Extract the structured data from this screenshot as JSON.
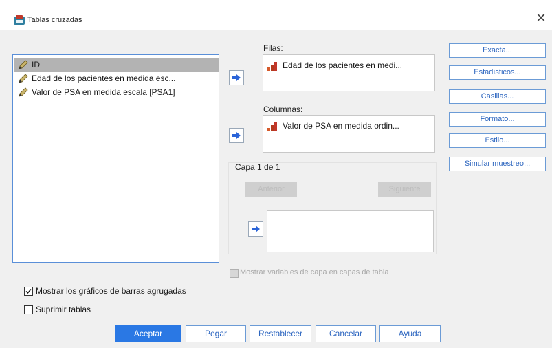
{
  "window": {
    "title": "Tablas cruzadas",
    "close_glyph": "✕"
  },
  "variables": [
    {
      "label": "ID",
      "icon": "pencil-icon",
      "selected": true
    },
    {
      "label": "Edad de los pacientes en medida esc...",
      "icon": "pencil-icon",
      "selected": false
    },
    {
      "label": "Valor de PSA en medida escala  [PSA1]",
      "icon": "pencil-icon",
      "selected": false
    }
  ],
  "rows": {
    "label": "Filas:",
    "items": [
      "Edad de los pacientes en medi..."
    ]
  },
  "columns": {
    "label": "Columnas:",
    "items": [
      "Valor de PSA en medida ordin..."
    ]
  },
  "layer": {
    "label": "Capa 1 de 1",
    "previous": "Anterior",
    "next": "Siguiente"
  },
  "show_layer_vars": {
    "label": "Mostrar variables de capa en capas de tabla",
    "checked": false,
    "disabled": true
  },
  "right_buttons": [
    "Exacta...",
    "Estadísticos...",
    "Casillas...",
    "Formato...",
    "Estilo...",
    "Simular muestreo..."
  ],
  "options": [
    {
      "label": "Mostrar los gráficos de barras agrugadas",
      "checked": true
    },
    {
      "label": "Suprimir tablas",
      "checked": false
    }
  ],
  "bottom_buttons": {
    "ok": "Aceptar",
    "paste": "Pegar",
    "reset": "Restablecer",
    "cancel": "Cancelar",
    "help": "Ayuda"
  },
  "colors": {
    "accent": "#2a78e4",
    "link_text": "#3068c0",
    "selection": "#b3b3b3"
  }
}
